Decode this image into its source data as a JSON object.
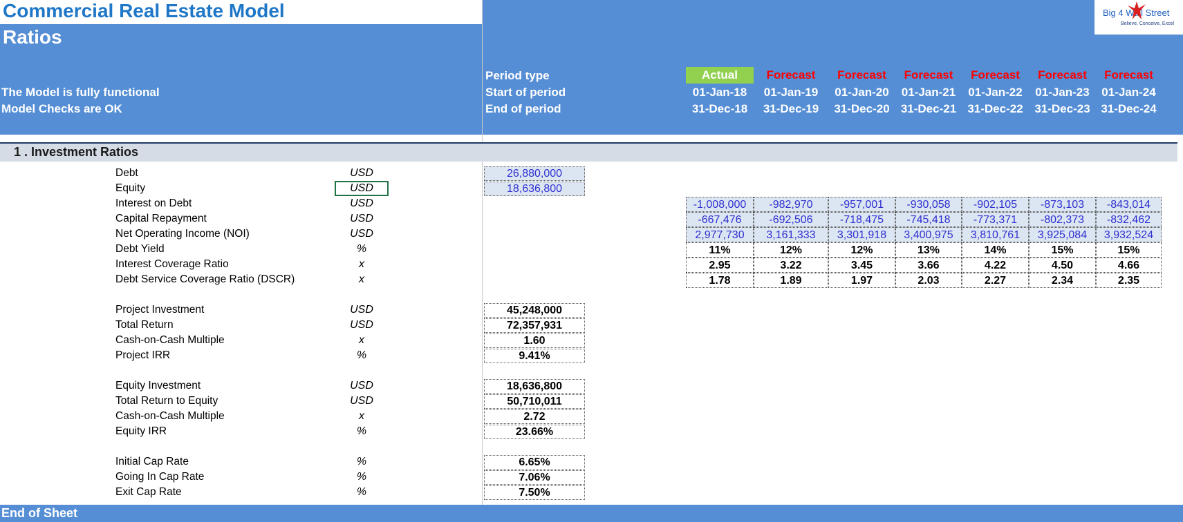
{
  "header": {
    "app_title": "Commercial Real Estate Model",
    "sheet_title": "Ratios",
    "status_functional": "The Model is fully functional",
    "status_checks": "Model Checks are OK",
    "period_type_label": "Period type",
    "start_label": "Start of period",
    "end_label": "End of period"
  },
  "logo": {
    "text": "Big 4 Wall Street",
    "tagline": "Believe, Conceive, Excel"
  },
  "periods": [
    {
      "type": "Actual",
      "start": "01-Jan-18",
      "end": "31-Dec-18"
    },
    {
      "type": "Forecast",
      "start": "01-Jan-19",
      "end": "31-Dec-19"
    },
    {
      "type": "Forecast",
      "start": "01-Jan-20",
      "end": "31-Dec-20"
    },
    {
      "type": "Forecast",
      "start": "01-Jan-21",
      "end": "31-Dec-21"
    },
    {
      "type": "Forecast",
      "start": "01-Jan-22",
      "end": "31-Dec-22"
    },
    {
      "type": "Forecast",
      "start": "01-Jan-23",
      "end": "31-Dec-23"
    },
    {
      "type": "Forecast",
      "start": "01-Jan-24",
      "end": "31-Dec-24"
    }
  ],
  "section": {
    "title": "1 . Investment Ratios"
  },
  "rows": [
    {
      "label": "Debt",
      "unit": "USD",
      "value": "26,880,000"
    },
    {
      "label": "Equity",
      "unit": "USD",
      "value": "18,636,800"
    },
    {
      "label": "Interest on Debt",
      "unit": "USD",
      "values": [
        "-1,008,000",
        "-982,970",
        "-957,001",
        "-930,058",
        "-902,105",
        "-873,103",
        "-843,014"
      ]
    },
    {
      "label": "Capital Repayment",
      "unit": "USD",
      "values": [
        "-667,476",
        "-692,506",
        "-718,475",
        "-745,418",
        "-773,371",
        "-802,373",
        "-832,462"
      ]
    },
    {
      "label": "Net Operating Income (NOI)",
      "unit": "USD",
      "values": [
        "2,977,730",
        "3,161,333",
        "3,301,918",
        "3,400,975",
        "3,810,761",
        "3,925,084",
        "3,932,524"
      ]
    },
    {
      "label": "Debt Yield",
      "unit": "%",
      "values": [
        "11%",
        "12%",
        "12%",
        "13%",
        "14%",
        "15%",
        "15%"
      ]
    },
    {
      "label": "Interest Coverage Ratio",
      "unit": "x",
      "values": [
        "2.95",
        "3.22",
        "3.45",
        "3.66",
        "4.22",
        "4.50",
        "4.66"
      ]
    },
    {
      "label": "Debt Service Coverage Ratio (DSCR)",
      "unit": "x",
      "values": [
        "1.78",
        "1.89",
        "1.97",
        "2.03",
        "2.27",
        "2.34",
        "2.35"
      ]
    },
    {
      "label": "Project Investment",
      "unit": "USD",
      "value": "45,248,000"
    },
    {
      "label": "Total Return",
      "unit": "USD",
      "value": "72,357,931"
    },
    {
      "label": "Cash-on-Cash Multiple",
      "unit": "x",
      "value": "1.60"
    },
    {
      "label": "Project IRR",
      "unit": "%",
      "value": "9.41%"
    },
    {
      "label": "Equity Investment",
      "unit": "USD",
      "value": "18,636,800"
    },
    {
      "label": "Total Return to  Equity",
      "unit": "USD",
      "value": "50,710,011"
    },
    {
      "label": "Cash-on-Cash Multiple",
      "unit": "x",
      "value": "2.72"
    },
    {
      "label": "Equity IRR",
      "unit": "%",
      "value": "23.66%"
    },
    {
      "label": "Initial Cap Rate",
      "unit": "%",
      "value": "6.65%"
    },
    {
      "label": "Going In Cap Rate",
      "unit": "%",
      "value": "7.06%"
    },
    {
      "label": "Exit Cap Rate",
      "unit": "%",
      "value": "7.50%"
    }
  ],
  "footer": {
    "text": "End of Sheet"
  },
  "colors": {
    "header_blue": "#558ed5",
    "title_blue": "#1f77c8",
    "actual_green": "#92d050",
    "forecast_red": "#ff0000",
    "input_fill": "#dce6f2",
    "input_text": "#2f2fd0"
  }
}
